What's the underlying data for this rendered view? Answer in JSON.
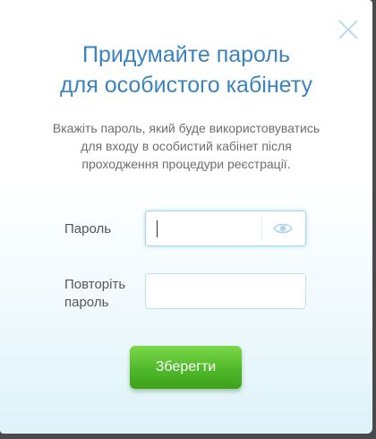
{
  "dialog": {
    "title_line1": "Придумайте пароль",
    "title_line2": "для особистого кабінету",
    "description_line1": "Вкажіть пароль, який буде використовуватись",
    "description_line2": "для входу в особистий кабінет після",
    "description_line3": "проходження процедури реєстрації.",
    "close_icon": "close-icon"
  },
  "form": {
    "password_label": "Пароль",
    "password_value": "",
    "password_toggle_icon": "eye-icon",
    "repeat_label_line1": "Повторіть",
    "repeat_label_line2": "пароль",
    "repeat_value": "",
    "save_label": "Зберегти"
  },
  "colors": {
    "title": "#3b83be",
    "button": "#4fb82a",
    "input_border": "#a8d6ea"
  }
}
